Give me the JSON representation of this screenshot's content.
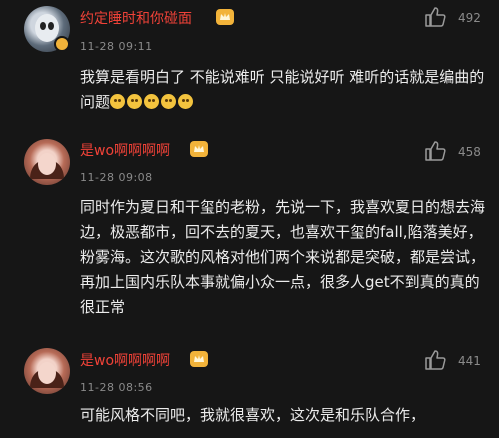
{
  "comments": [
    {
      "username": "约定睡时和你碰面",
      "time": "11-28 09:11",
      "likes": "492",
      "text": "我算是看明白了 不能说难听 只能说好听 难听的话就是编曲的问题",
      "emoji_count": 5,
      "emoji_icon": "sad-face-emoji-icon"
    },
    {
      "username": "是wo啊啊啊啊",
      "time": "11-28 09:08",
      "likes": "458",
      "text": "同时作为夏日和干玺的老粉，先说一下，我喜欢夏日的想去海边，极恶都市，回不去的夏天，也喜欢干玺的fall,陷落美好，粉雾海。这次歌的风格对他们两个来说都是突破，都是尝试，再加上国内乐队本事就偏小众一点，很多人get不到真的真的很正常"
    },
    {
      "username": "是wo啊啊啊啊",
      "time": "11-28 08:56",
      "likes": "441",
      "text": "可能风格不同吧，我就很喜欢，这次是和乐队合作，"
    }
  ],
  "colors": {
    "username": "#f04238",
    "background": "#161616",
    "crown": "#f2b33a"
  }
}
